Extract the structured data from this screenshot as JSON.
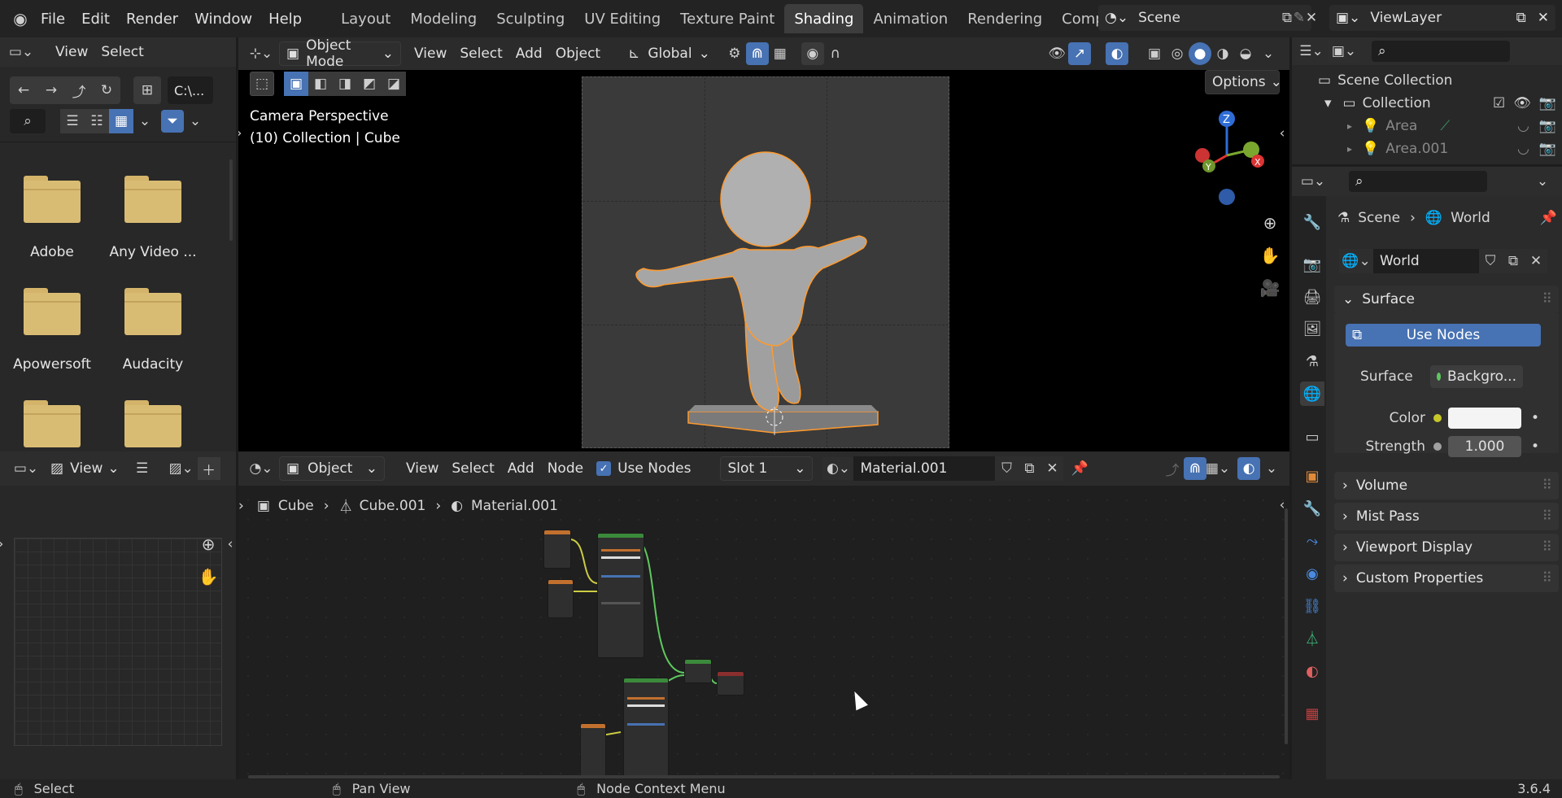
{
  "topbar": {
    "menus": [
      "File",
      "Edit",
      "Render",
      "Window",
      "Help"
    ],
    "workspaces": [
      "Layout",
      "Modeling",
      "Sculpting",
      "UV Editing",
      "Texture Paint",
      "Shading",
      "Animation",
      "Rendering",
      "Compositin"
    ],
    "active_workspace": "Shading",
    "scene": "Scene",
    "view_layer": "ViewLayer"
  },
  "file_browser": {
    "menus": [
      "View",
      "Select"
    ],
    "path": "C:\\...",
    "folders": [
      "Adobe",
      "Any Video ...",
      "Apowersoft",
      "Audacity",
      "",
      ""
    ]
  },
  "viewport": {
    "mode": "Object Mode",
    "menus": [
      "View",
      "Select",
      "Add",
      "Object"
    ],
    "transform": "Global",
    "options": "Options",
    "overlay_line1": "Camera Perspective",
    "overlay_line2": "(10) Collection | Cube",
    "gizmo": {
      "z": "Z",
      "x": "X",
      "y": "Y"
    }
  },
  "image_editor": {
    "view": "View"
  },
  "node_editor": {
    "type": "Object",
    "menus": [
      "View",
      "Select",
      "Add",
      "Node"
    ],
    "use_nodes": "Use Nodes",
    "slot": "Slot 1",
    "material": "Material.001",
    "breadcrumb": [
      "Cube",
      "Cube.001",
      "Material.001"
    ]
  },
  "outliner": {
    "scene_collection": "Scene Collection",
    "collection": "Collection",
    "items": [
      "Area",
      "Area.001"
    ]
  },
  "properties": {
    "breadcrumb": [
      "Scene",
      "World"
    ],
    "world_name": "World",
    "surface_section": "Surface",
    "use_nodes": "Use Nodes",
    "surface_label": "Surface",
    "surface_value": "Backgro...",
    "color_label": "Color",
    "strength_label": "Strength",
    "strength_value": "1.000",
    "sections": [
      "Volume",
      "Mist Pass",
      "Viewport Display",
      "Custom Properties"
    ]
  },
  "statusbar": {
    "select": "Select",
    "pan": "Pan View",
    "context": "Node Context Menu",
    "version": "3.6.4"
  },
  "colors": {
    "accent": "#4772b3",
    "selection_outline": "#ff9a2e",
    "folder": "#d9bc74"
  }
}
